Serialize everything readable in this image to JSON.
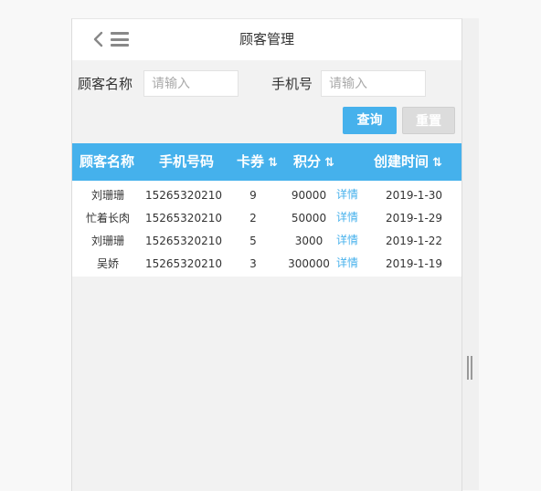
{
  "header": {
    "title": "顾客管理"
  },
  "search": {
    "name_label": "顾客名称",
    "name_placeholder": "请输入",
    "phone_label": "手机号",
    "phone_placeholder": "请输入",
    "query_label": "查询",
    "reset_label": "重置"
  },
  "table": {
    "headers": {
      "name": "顾客名称",
      "phone": "手机号码",
      "coupons": "卡券",
      "points": "积分",
      "created": "创建时间"
    },
    "sort_glyph": "⇅",
    "rows": [
      {
        "name": "刘珊珊",
        "phone": "15265320210",
        "coupons": "9",
        "points": "90000",
        "detail": "详情",
        "created": "2019-1-30"
      },
      {
        "name": "忙着长肉",
        "phone": "15265320210",
        "coupons": "2",
        "points": "50000",
        "detail": "详情",
        "created": "2019-1-29"
      },
      {
        "name": "刘珊珊",
        "phone": "15265320210",
        "coupons": "5",
        "points": "3000",
        "detail": "详情",
        "created": "2019-1-22"
      },
      {
        "name": "吴娇",
        "phone": "15265320210",
        "coupons": "3",
        "points": "300000",
        "detail": "详情",
        "created": "2019-1-19"
      }
    ]
  },
  "colors": {
    "accent": "#46b1ec",
    "reset": "#dcdcdc"
  }
}
